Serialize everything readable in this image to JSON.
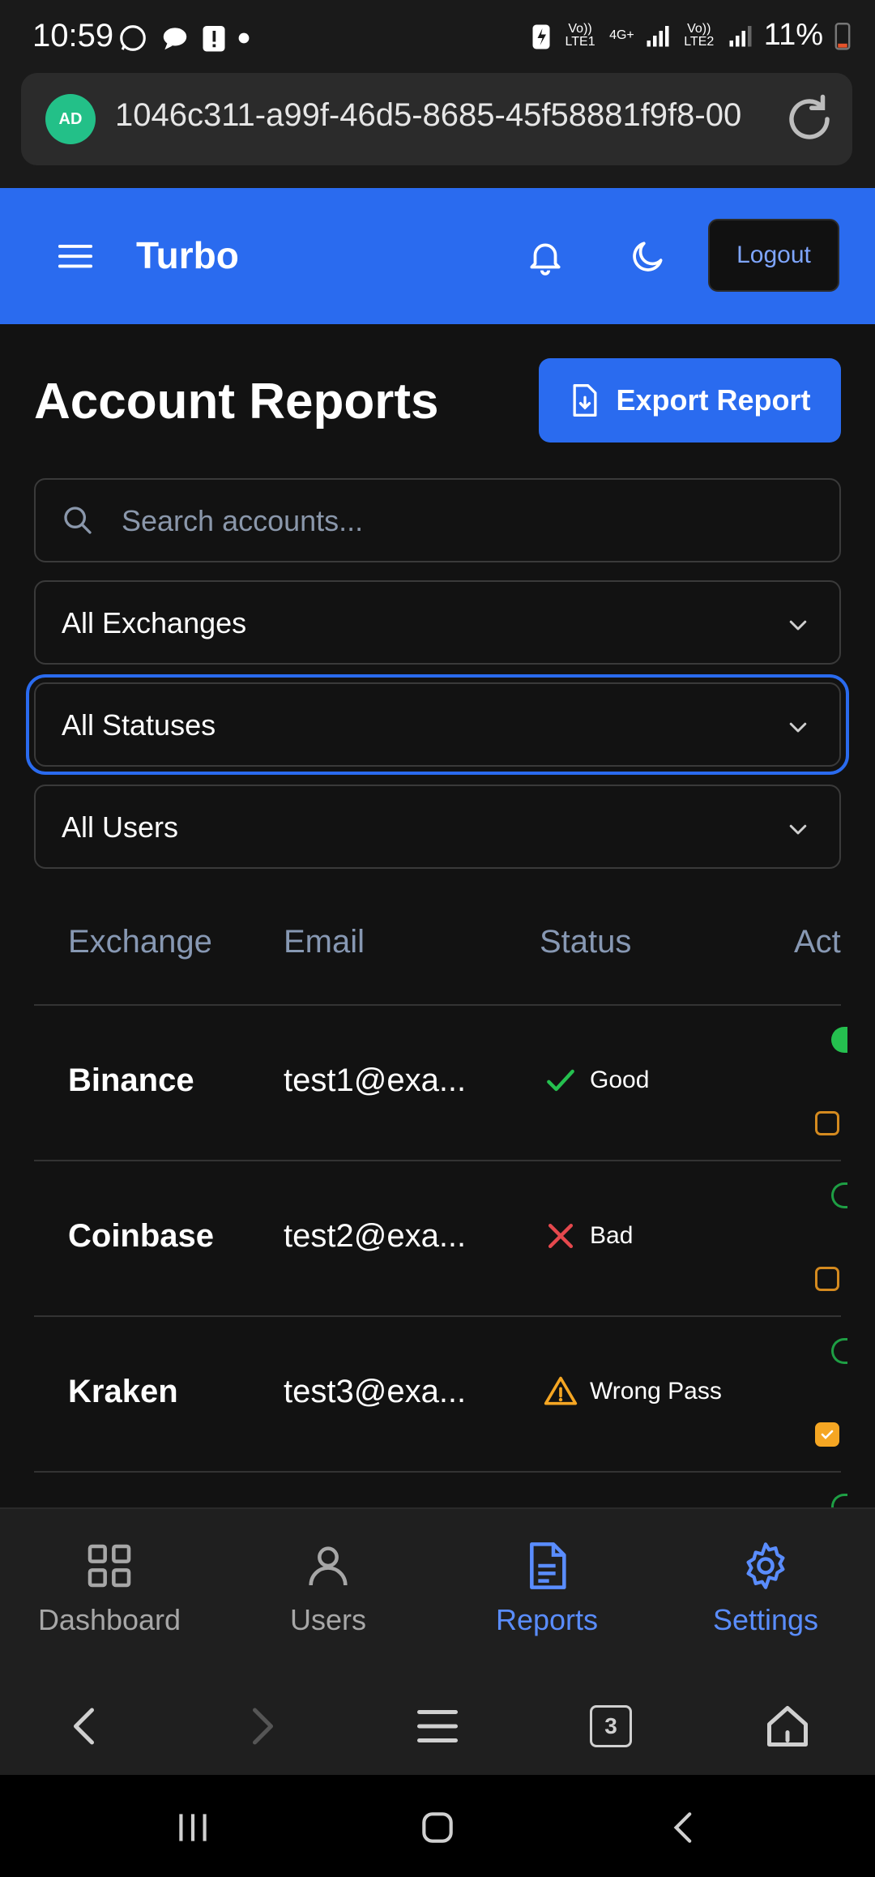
{
  "status_bar": {
    "time": "10:59",
    "battery": "11%",
    "net1": "Vo)) LTE1",
    "net2": "4G+",
    "net3": "Vo)) LTE2"
  },
  "browser": {
    "url": "1046c311-a99f-46d5-8685-45f58881f9f8-00",
    "shield_label": "AD"
  },
  "header": {
    "brand": "Turbo",
    "logout_label": "Logout"
  },
  "page": {
    "title": "Account Reports",
    "export_label": "Export Report",
    "search_placeholder": "Search accounts...",
    "filters": {
      "exchange": "All Exchanges",
      "status": "All Statuses",
      "user": "All Users"
    }
  },
  "table": {
    "headers": {
      "exchange": "Exchange",
      "email": "Email",
      "status": "Status",
      "actions": "Act"
    },
    "rows": [
      {
        "exchange": "Binance",
        "email": "test1@exa...",
        "status": "Good",
        "status_type": "good",
        "toggle_on": true,
        "checked": false
      },
      {
        "exchange": "Coinbase",
        "email": "test2@exa...",
        "status": "Bad",
        "status_type": "bad",
        "toggle_on": false,
        "checked": false
      },
      {
        "exchange": "Kraken",
        "email": "test3@exa...",
        "status": "Wrong Pass",
        "status_type": "warn",
        "toggle_on": false,
        "checked": true
      }
    ]
  },
  "bottom_nav": [
    {
      "label": "Dashboard",
      "icon": "grid-icon",
      "active": false
    },
    {
      "label": "Users",
      "icon": "user-icon",
      "active": false
    },
    {
      "label": "Reports",
      "icon": "document-icon",
      "active": true
    },
    {
      "label": "Settings",
      "icon": "gear-icon",
      "active": true
    }
  ],
  "browser_nav": {
    "tabs_count": "3"
  },
  "colors": {
    "accent": "#2a6bef",
    "good": "#25c04f",
    "bad": "#e5484d",
    "warn": "#f5a623",
    "nav_active": "#5a8dff"
  }
}
